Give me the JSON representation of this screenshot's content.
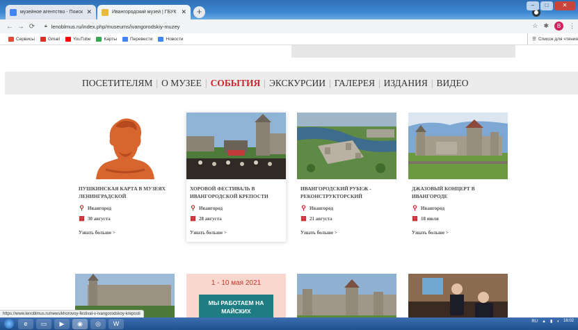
{
  "browser": {
    "tabs": [
      {
        "title": "музейное агентство - Поиск в Г",
        "active": false,
        "favicon_color": "#4285f4"
      },
      {
        "title": "Ивангородский музей | ГБУК Л",
        "active": true,
        "favicon_color": "#e8b93a"
      }
    ],
    "url": "lenoblmus.ru/index.php/museums/ivangorodskiy-muzey",
    "profile_initial": "B",
    "bookmarks": [
      {
        "label": "Сервисы",
        "icon": "apps-grid-icon",
        "color": "#e24a33"
      },
      {
        "label": "Gmail",
        "icon": "gmail-icon",
        "color": "#d93025"
      },
      {
        "label": "YouTube",
        "icon": "youtube-icon",
        "color": "#ff0000"
      },
      {
        "label": "Карты",
        "icon": "maps-icon",
        "color": "#34a853"
      },
      {
        "label": "Перевести",
        "icon": "translate-icon",
        "color": "#4285f4"
      },
      {
        "label": "Новости",
        "icon": "news-icon",
        "color": "#4285f4"
      }
    ],
    "reading_list": "Список для чтения",
    "status_url": "https://www.lenoblmus.ru/news/khorovoy-festival-v-ivangorodskoy-kreposti"
  },
  "nav": {
    "items": [
      {
        "label": "ПОСЕТИТЕЛЯМ",
        "active": false
      },
      {
        "label": "О МУЗЕЕ",
        "active": false
      },
      {
        "label": "СОБЫТИЯ",
        "active": true
      },
      {
        "label": "ЭКСКУРСИИ",
        "active": false
      },
      {
        "label": "ГАЛЕРЕЯ",
        "active": false
      },
      {
        "label": "ИЗДАНИЯ",
        "active": false
      },
      {
        "label": "ВИДЕО",
        "active": false
      }
    ]
  },
  "events": [
    {
      "title": "ПУШКИНСКАЯ КАРТА В МУЗЕЯХ ЛЕНИНГРАДСКОЙ",
      "place": "Ивангород",
      "date": "30 августа",
      "more": "Узнать больше >"
    },
    {
      "title": "ХОРОВОЙ ФЕСТИВАЛЬ В ИВАНГОРОДСКОЙ КРЕПОСТИ",
      "place": "Ивангород",
      "date": "28 августа",
      "more": "Узнать больше >"
    },
    {
      "title": "ИВАНГОРОДСКИЙ РУБЕЖ - РЕКОНСТРУКТОРСКИЙ",
      "place": "Ивангород",
      "date": "21 августа",
      "more": "Узнать больше >"
    },
    {
      "title": "ДЖАЗОВЫЙ КОНЦЕРТ В ИВАНГОРОДЕ",
      "place": "Ивангород",
      "date": "18 июля",
      "more": "Узнать больше >"
    }
  ],
  "promo": {
    "dates": "1 - 10 мая 2021",
    "text_line1": "МЫ РАБОТАЕМ НА",
    "text_line2": "МАЙСКИХ"
  },
  "taskbar": {
    "lang": "RU",
    "time": "16:02"
  }
}
